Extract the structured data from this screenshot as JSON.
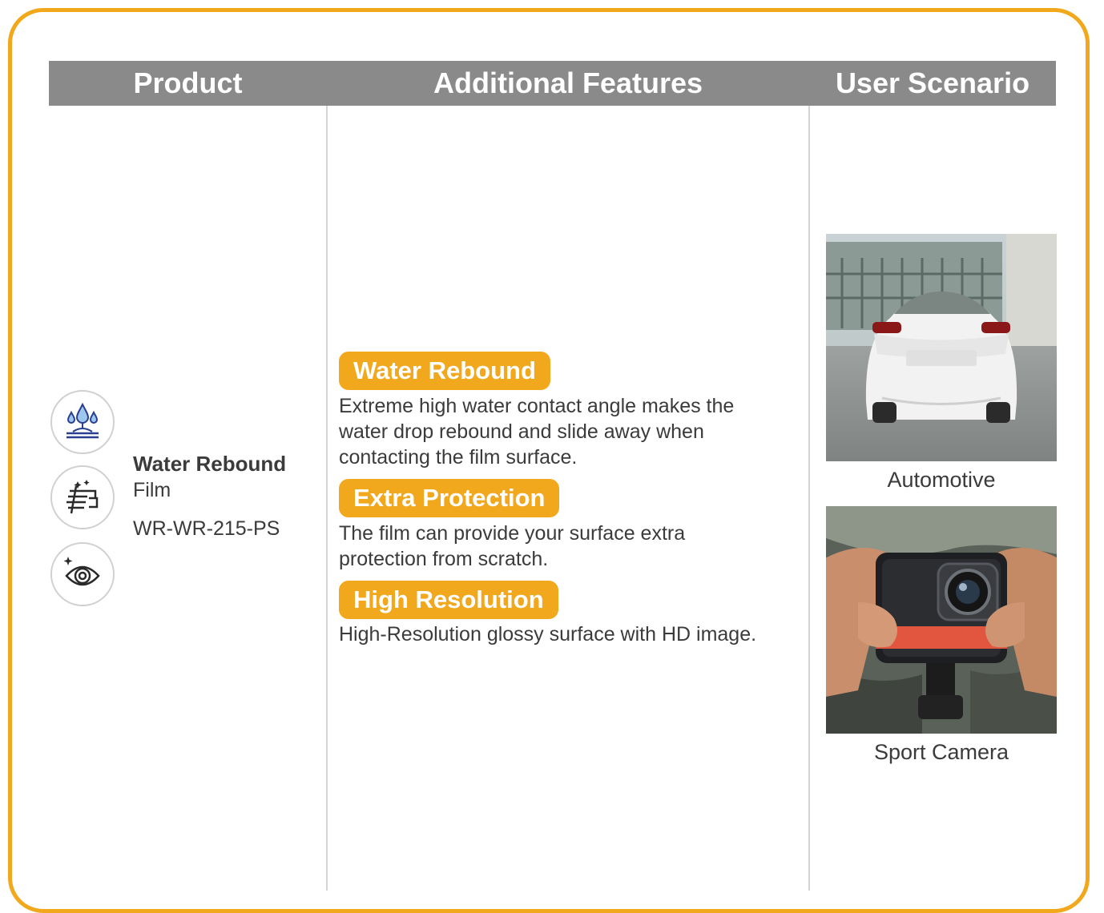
{
  "header": {
    "product": "Product",
    "features": "Additional Features",
    "scenario": "User Scenario"
  },
  "product": {
    "name": "Water Rebound",
    "subtitle": "Film",
    "code": "WR-WR-215-PS",
    "icons": [
      "water-drops-icon",
      "scratch-shield-icon",
      "eye-icon"
    ]
  },
  "features": [
    {
      "title": "Water Rebound",
      "lines": [
        "Extreme high water contact angle makes the",
        "water drop rebound and slide away when",
        "contacting the film surface."
      ]
    },
    {
      "title": "Extra Protection",
      "lines": [
        "The film can provide your surface extra",
        "protection from scratch."
      ]
    },
    {
      "title": "High Resolution",
      "lines": [
        "High-Resolution glossy surface with HD image."
      ]
    }
  ],
  "scenarios": [
    {
      "caption": "Automotive",
      "image": "white-car-rear-photo"
    },
    {
      "caption": "Sport Camera",
      "image": "action-camera-in-hands-photo"
    }
  ],
  "colors": {
    "accent": "#f2a81d",
    "header_bg": "#8a8a8a",
    "text": "#3b3b3b"
  }
}
